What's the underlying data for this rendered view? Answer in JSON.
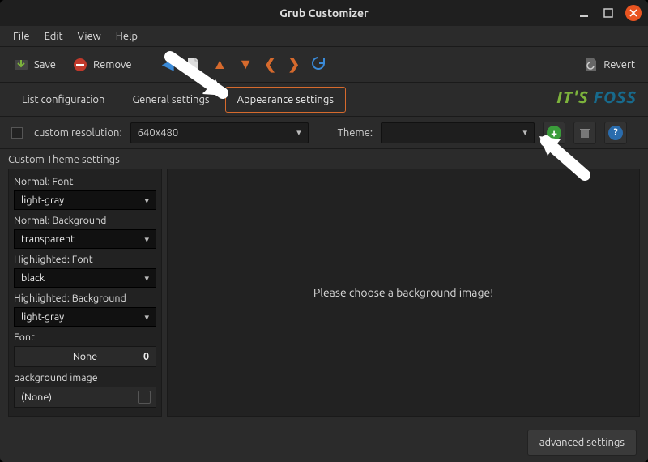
{
  "window": {
    "title": "Grub Customizer"
  },
  "menu": {
    "file": "File",
    "edit": "Edit",
    "view": "View",
    "help": "Help"
  },
  "toolbar": {
    "save": "Save",
    "remove": "Remove",
    "revert": "Revert"
  },
  "tabs": {
    "list": "List configuration",
    "general": "General settings",
    "appearance": "Appearance settings"
  },
  "logo": {
    "part1": "IT'S ",
    "part2": "FOSS"
  },
  "settings": {
    "custom_resolution_label": "custom resolution:",
    "custom_resolution_value": "640x480",
    "theme_label": "Theme:",
    "theme_value": ""
  },
  "custom_theme": {
    "section_label": "Custom Theme settings",
    "normal_font_label": "Normal: Font",
    "normal_font_value": "light-gray",
    "normal_bg_label": "Normal: Background",
    "normal_bg_value": "transparent",
    "hl_font_label": "Highlighted: Font",
    "hl_font_value": "black",
    "hl_bg_label": "Highlighted: Background",
    "hl_bg_value": "light-gray",
    "font_label": "Font",
    "font_value": "None",
    "font_size": "0",
    "bg_image_label": "background image",
    "bg_image_value": "(None)"
  },
  "preview": {
    "placeholder": "Please choose a background image!"
  },
  "footer": {
    "advanced": "advanced settings"
  }
}
